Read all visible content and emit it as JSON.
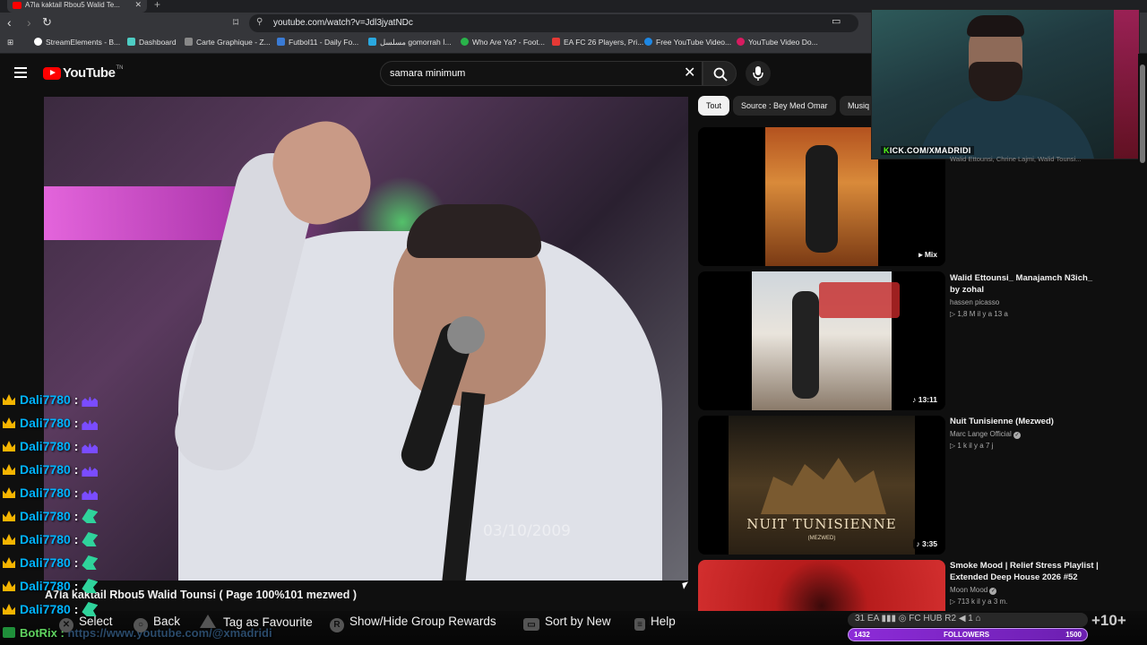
{
  "browser": {
    "tab_title": "A7la kaktail Rbou5 Walid Te...",
    "url": "youtube.com/watch?v=Jdl3jyatNDc",
    "bookmarks": [
      {
        "label": "StreamElements - B...",
        "icon": "streamelements-icon",
        "color": "#ffffff"
      },
      {
        "label": "Dashboard",
        "icon": "dashboard-icon",
        "color": "#4ecdc4"
      },
      {
        "label": "Carte Graphique - Z...",
        "icon": "shop-icon",
        "color": "#888888"
      },
      {
        "label": "Futbol11 - Daily Fo...",
        "icon": "futbol-icon",
        "color": "#3a7bd5"
      },
      {
        "label": "مسلسل gomorrah ا...",
        "icon": "series-icon",
        "color": "#2aa8e0"
      },
      {
        "label": "Who Are Ya? - Foot...",
        "icon": "football-icon",
        "color": "#29b34a"
      },
      {
        "label": "EA FC 26 Players, Pri...",
        "icon": "ea-icon",
        "color": "#e53935"
      },
      {
        "label": "Free YouTube Video...",
        "icon": "video-icon",
        "color": "#1e88e5"
      },
      {
        "label": "YouTube Video Do...",
        "icon": "youtube-icon",
        "color": "#d81b60"
      }
    ]
  },
  "youtube": {
    "logo_word": "YouTube",
    "logo_region": "TN",
    "search_query": "samara minimum",
    "chips": [
      "Tout",
      "Source : Bey Med Omar",
      "Musiq"
    ],
    "video_title": "A7la kaktail Rbou5 Walid Tounsi ( Page 100%101 mezwed )",
    "video_timestamp": "03/10/2009",
    "recommendations": [
      {
        "title": "",
        "channel": "",
        "meta": "",
        "badge": "Mix",
        "caption": "Walid Ettounsi, Chrine Lajmi, Walid Tounsi..."
      },
      {
        "title": "Walid Ettounsi_ Manajamch N3ich_ by zohal",
        "channel": "hassen picasso",
        "meta": "1,8 M  il y a 13 a",
        "badge": "13:11"
      },
      {
        "title": "Nuit Tunisienne (Mezwed)",
        "channel": "Marc Lange Official",
        "meta": "1 k  il y a 7 j",
        "badge": "3:35",
        "thumb_text": "NUIT TUNISIENNE",
        "thumb_sub": "(MEZWED)"
      },
      {
        "title": "Smoke Mood | Relief Stress Playlist | Extended Deep House 2026 #52",
        "channel": "Moon Mood",
        "meta": "713 k  il y a 3 m.",
        "badge": ""
      }
    ]
  },
  "webcam": {
    "kick_prefix": "K",
    "kick_url": "ICK.COM/XMADRIDI"
  },
  "chat": {
    "lines": [
      {
        "user": "Dali7780",
        "emote": "purple"
      },
      {
        "user": "Dali7780",
        "emote": "purple"
      },
      {
        "user": "Dali7780",
        "emote": "purple"
      },
      {
        "user": "Dali7780",
        "emote": "purple"
      },
      {
        "user": "Dali7780",
        "emote": "purple"
      },
      {
        "user": "Dali7780",
        "emote": "green"
      },
      {
        "user": "Dali7780",
        "emote": "green"
      },
      {
        "user": "Dali7780",
        "emote": "green"
      },
      {
        "user": "Dali7780",
        "emote": "green"
      },
      {
        "user": "Dali7780",
        "emote": "green"
      }
    ],
    "bot_name": "BotRix",
    "bot_text": "https://www.youtube.com/@xmadridi"
  },
  "controls": {
    "select": {
      "glyph": "✕",
      "label": "Select"
    },
    "back": {
      "glyph": "○",
      "label": "Back"
    },
    "favourite": {
      "glyph": "△",
      "label": "Tag as Favourite"
    },
    "rewards": {
      "glyph": "R",
      "label": "Show/Hide Group Rewards"
    },
    "sort": {
      "glyph": "▭",
      "label": "Sort by New"
    },
    "help": {
      "glyph": "≡",
      "label": "Help"
    }
  },
  "followers": {
    "icons_text": "31  EA  ▮▮▮  ◎  FC HUB  R2  ◀  1  ⌂",
    "current": "1432",
    "label": "FOLLOWERS",
    "goal": "1500",
    "plus": "+10+"
  }
}
